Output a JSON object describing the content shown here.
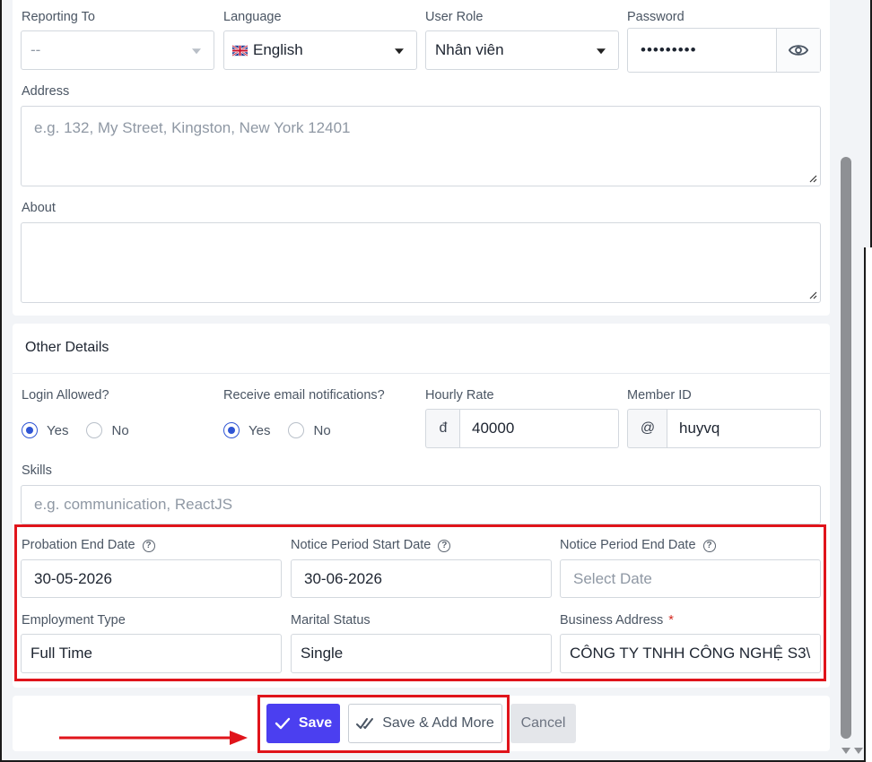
{
  "profile": {
    "reporting_to": {
      "label": "Reporting To",
      "value": "--"
    },
    "language": {
      "label": "Language",
      "value": "English"
    },
    "user_role": {
      "label": "User Role",
      "value": "Nhân viên"
    },
    "password": {
      "label": "Password",
      "value": "•••••••••"
    },
    "address": {
      "label": "Address",
      "placeholder": "e.g. 132, My Street, Kingston, New York 12401"
    },
    "about": {
      "label": "About"
    }
  },
  "other_details": {
    "title": "Other Details",
    "login_allowed": {
      "label": "Login Allowed?",
      "yes": "Yes",
      "no": "No",
      "selected": "Yes"
    },
    "email_notifications": {
      "label": "Receive email notifications?",
      "yes": "Yes",
      "no": "No",
      "selected": "Yes"
    },
    "hourly_rate": {
      "label": "Hourly Rate",
      "prefix": "đ",
      "value": "40000"
    },
    "member_id": {
      "label": "Member ID",
      "prefix": "@",
      "value": "huyvq"
    },
    "skills": {
      "label": "Skills",
      "placeholder": "e.g. communication, ReactJS"
    },
    "probation_end_date": {
      "label": "Probation End Date",
      "value": "30-05-2026"
    },
    "notice_start_date": {
      "label": "Notice Period Start Date",
      "value": "30-06-2026"
    },
    "notice_end_date": {
      "label": "Notice Period End Date",
      "placeholder": "Select Date"
    },
    "employment_type": {
      "label": "Employment Type",
      "value": "Full Time"
    },
    "marital_status": {
      "label": "Marital Status",
      "value": "Single"
    },
    "business_address": {
      "label": "Business Address",
      "required": "*",
      "value": "CÔNG TY TNHH CÔNG NGHỆ S3\\"
    }
  },
  "actions": {
    "save": "Save",
    "save_add_more": "Save & Add More",
    "cancel": "Cancel"
  },
  "colors": {
    "primary": "#4b3ff0",
    "highlight": "#e0141b",
    "radio_checked": "#2f55d4"
  },
  "icons": {
    "flag": "uk-flag-icon",
    "password_toggle": "eye-icon",
    "help": "question-circle-icon",
    "save": "check-icon",
    "save_add_more": "double-check-icon",
    "annotation": "arrow-right-icon"
  }
}
